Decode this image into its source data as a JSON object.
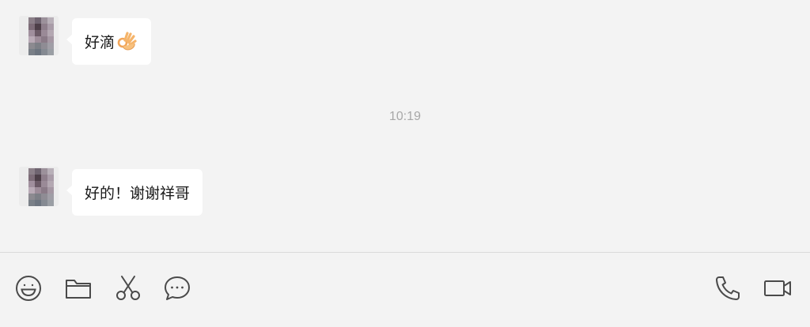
{
  "messages": [
    {
      "sender": "contact",
      "text": "好滴",
      "emoji": "ok-hand-emoji"
    },
    {
      "sender": "contact",
      "text": "好的！谢谢祥哥"
    }
  ],
  "timestamp": "10:19",
  "toolbar": {
    "left_icons": [
      "emoji-icon",
      "folder-icon",
      "scissors-icon",
      "chat-bubble-icon"
    ],
    "right_icons": [
      "phone-icon",
      "video-call-icon"
    ]
  },
  "colors": {
    "background": "#f3f3f3",
    "bubble": "#ffffff",
    "timestamp": "#a8a8a8",
    "icon": "#4a4a4a"
  }
}
